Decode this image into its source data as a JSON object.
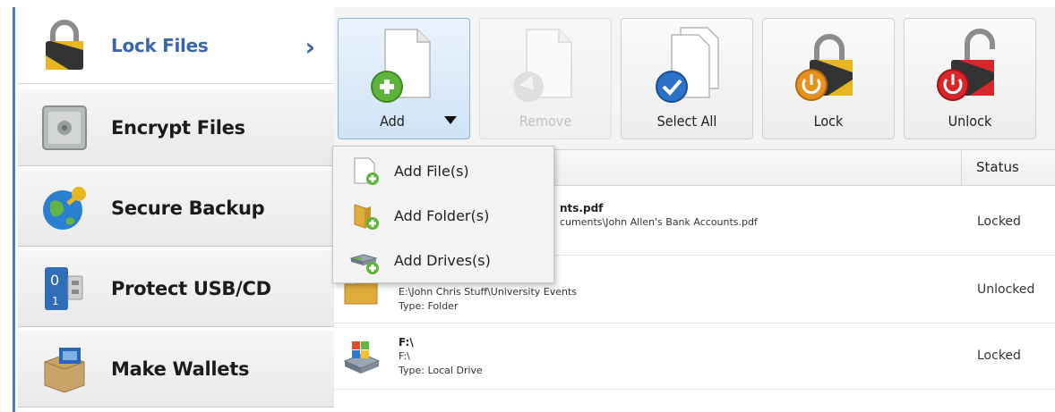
{
  "sidebar": {
    "items": [
      {
        "label": "Lock Files",
        "icon": "padlock-icon",
        "active": true
      },
      {
        "label": "Encrypt Files",
        "icon": "safe-icon"
      },
      {
        "label": "Secure Backup",
        "icon": "globe-key-icon"
      },
      {
        "label": "Protect USB/CD",
        "icon": "usb-drive-icon"
      },
      {
        "label": "Make Wallets",
        "icon": "wallet-box-icon"
      }
    ],
    "chevron": "›"
  },
  "toolbar": {
    "add_label": "Add",
    "remove_label": "Remove",
    "select_all_label": "Select All",
    "lock_label": "Lock",
    "unlock_label": "Unlock"
  },
  "dropdown": {
    "items": [
      {
        "label": "Add File(s)",
        "icon": "add-file-icon"
      },
      {
        "label": "Add Folder(s)",
        "icon": "add-folder-icon"
      },
      {
        "label": "Add Drives(s)",
        "icon": "add-drive-icon"
      }
    ]
  },
  "list": {
    "columns": {
      "status": "Status"
    },
    "rows": [
      {
        "name": "nts.pdf",
        "path": "cuments\\John Allen's Bank Accounts.pdf",
        "type": "",
        "status": "Locked"
      },
      {
        "name": "",
        "path": "E:\\John Chris Stuff\\University Events",
        "type": "Type: Folder",
        "status": "Unlocked"
      },
      {
        "name": "F:\\",
        "path": "F:\\",
        "type": "Type: Local Drive",
        "status": "Locked"
      }
    ]
  },
  "colors": {
    "accent": "#3a65ad",
    "add_bg": "#cfe3f6",
    "lock_orange": "#e8901c",
    "unlock_red": "#d8262b",
    "check_blue": "#2a73c9",
    "plus_green": "#5db43a"
  }
}
